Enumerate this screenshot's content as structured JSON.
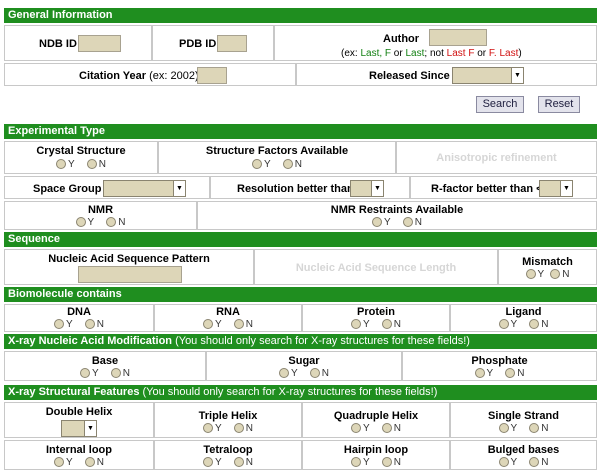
{
  "sections": {
    "general": "General Information",
    "experimental": "Experimental Type",
    "sequence": "Sequence",
    "biomolecule": "Biomolecule contains",
    "xray_mod": "X-ray Nucleic Acid Modification",
    "xray_mod_note": "(You should only search for X-ray structures for these fields!)",
    "xray_struct": "X-ray Structural Features",
    "xray_struct_note": "(You should only search for X-ray structures for these fields!)"
  },
  "general": {
    "ndb_id": "NDB ID",
    "pdb_id": "PDB ID",
    "author": "Author",
    "author_hint_pre": "(ex: ",
    "author_hint_a": "Last",
    "author_hint_sep1": ", ",
    "author_hint_b": "F",
    "author_hint_or": " or ",
    "author_hint_c": "Last",
    "author_hint_not": "; not ",
    "author_hint_d": "Last F",
    "author_hint_or2": " or ",
    "author_hint_e": "F. Last",
    "author_hint_post": ")",
    "citation_year": "Citation Year",
    "citation_hint": "(ex: 2002)",
    "released_since": "Released Since"
  },
  "buttons": {
    "search": "Search",
    "reset": "Reset"
  },
  "radio": {
    "y": "Y",
    "n": "N"
  },
  "experimental": {
    "crystal": "Crystal Structure",
    "sf": "Structure Factors Available",
    "aniso": "Anisotropic refinement",
    "space_group": "Space Group",
    "resolution": "Resolution better than",
    "rfactor": "R-factor better than <",
    "nmr": "NMR",
    "nmr_restraints": "NMR Restraints Available"
  },
  "sequence": {
    "pattern": "Nucleic Acid Sequence Pattern",
    "length": "Nucleic Acid Sequence Length",
    "mismatch": "Mismatch"
  },
  "biomolecule": {
    "dna": "DNA",
    "rna": "RNA",
    "protein": "Protein",
    "ligand": "Ligand"
  },
  "xray_mod": {
    "base": "Base",
    "sugar": "Sugar",
    "phosphate": "Phosphate"
  },
  "xray_struct": {
    "double_helix": "Double Helix",
    "triple_helix": "Triple Helix",
    "quadruple_helix": "Quadruple Helix",
    "single_strand": "Single Strand",
    "internal_loop": "Internal loop",
    "tetraloop": "Tetraloop",
    "hairpin_loop": "Hairpin loop",
    "bulged_bases": "Bulged bases"
  },
  "colors": {
    "header_green": "#1f8e1f",
    "input_bg": "#ddd6b8",
    "hint_green": "#138013",
    "hint_red": "#d01010"
  }
}
